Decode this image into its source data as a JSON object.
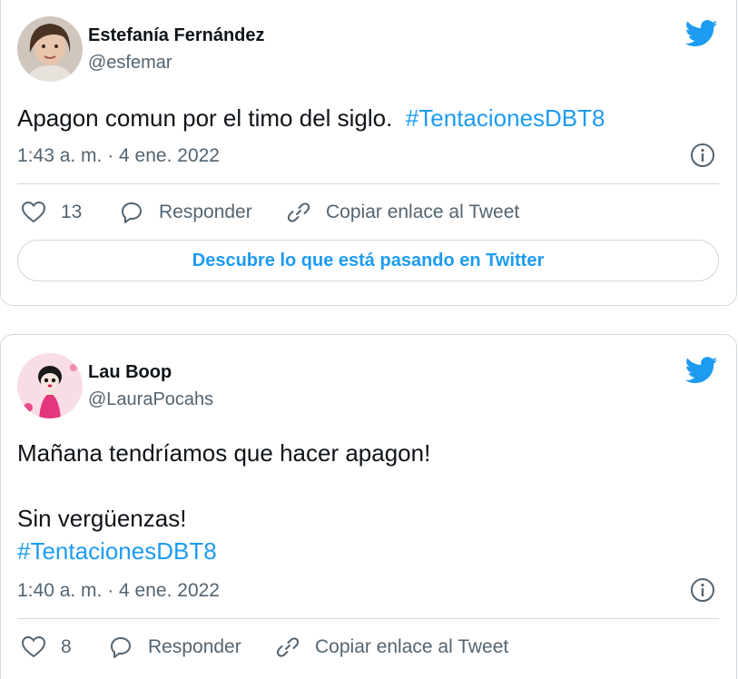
{
  "colors": {
    "accent": "#1d9bf0",
    "muted": "#536471",
    "border": "#cfd9de"
  },
  "tweets": [
    {
      "author": "Estefanía Fernández",
      "handle": "@esfemar",
      "text": "Apagon comun por el timo del siglo.",
      "hashtag": "#TentacionesDBT8",
      "timestamp": "1:43 a. m. · 4 ene. 2022",
      "likes": "13",
      "reply_label": "Responder",
      "copy_label": "Copiar enlace al Tweet",
      "cta_label": "Descubre lo que está pasando en Twitter",
      "icons": [
        "twitter-bird-icon",
        "info-icon",
        "heart-icon",
        "reply-icon",
        "link-icon"
      ]
    },
    {
      "author": "Lau Boop",
      "handle": "@LauraPocahs",
      "text_line1": "Mañana tendríamos que hacer apagon!",
      "text_line2": "Sin vergüenzas!",
      "hashtag": "#TentacionesDBT8",
      "timestamp": "1:40 a. m. · 4 ene. 2022",
      "likes": "8",
      "reply_label": "Responder",
      "copy_label": "Copiar enlace al Tweet",
      "icons": [
        "twitter-bird-icon",
        "info-icon",
        "heart-icon",
        "reply-icon",
        "link-icon"
      ]
    }
  ]
}
